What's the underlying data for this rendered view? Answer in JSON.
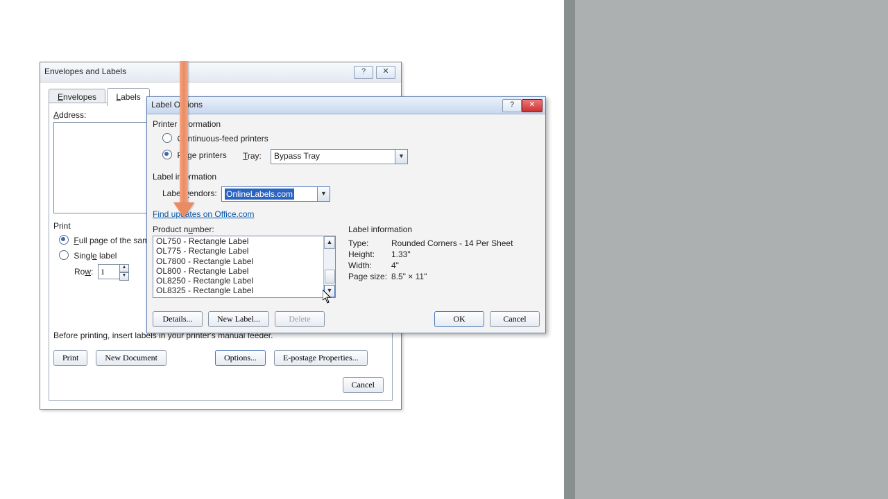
{
  "dlg1": {
    "title": "Envelopes and Labels",
    "tabs": {
      "envelopes": "Envelopes",
      "labels": "Labels"
    },
    "address_label": "Address:",
    "print_group": {
      "title": "Print",
      "full": "Full page of the same label",
      "single": "Single label",
      "row_label": "Row:",
      "row_value": "1"
    },
    "hint": "Before printing, insert labels in your printer's manual feeder.",
    "buttons": {
      "print": "Print",
      "newdoc": "New Document",
      "options": "Options...",
      "epostage": "E-postage Properties...",
      "cancel": "Cancel"
    }
  },
  "dlg2": {
    "title": "Label Options",
    "printer_info": "Printer information",
    "continuous": "Continuous-feed printers",
    "page_printers": "Page printers",
    "tray_label": "Tray:",
    "tray_value": "Bypass Tray",
    "label_info": "Label information",
    "vendors_label": "Label vendors:",
    "vendors_value": "OnlineLabels.com",
    "updates_link": "Find updates on Office.com",
    "prodnum_label": "Product number:",
    "products": [
      "OL750 - Rectangle Label",
      "OL775 - Rectangle Label",
      "OL7800 - Rectangle Label",
      "OL800 - Rectangle Label",
      "OL8250 - Rectangle Label",
      "OL8325 - Rectangle Label"
    ],
    "info_panel": {
      "header": "Label information",
      "rows": {
        "type_k": "Type:",
        "type_v": "Rounded Corners - 14 Per Sheet",
        "height_k": "Height:",
        "height_v": "1.33\"",
        "width_k": "Width:",
        "width_v": "4\"",
        "page_k": "Page size:",
        "page_v": "8.5\" × 11\""
      }
    },
    "buttons": {
      "details": "Details...",
      "newlabel": "New Label...",
      "delete": "Delete",
      "ok": "OK",
      "cancel": "Cancel"
    }
  }
}
